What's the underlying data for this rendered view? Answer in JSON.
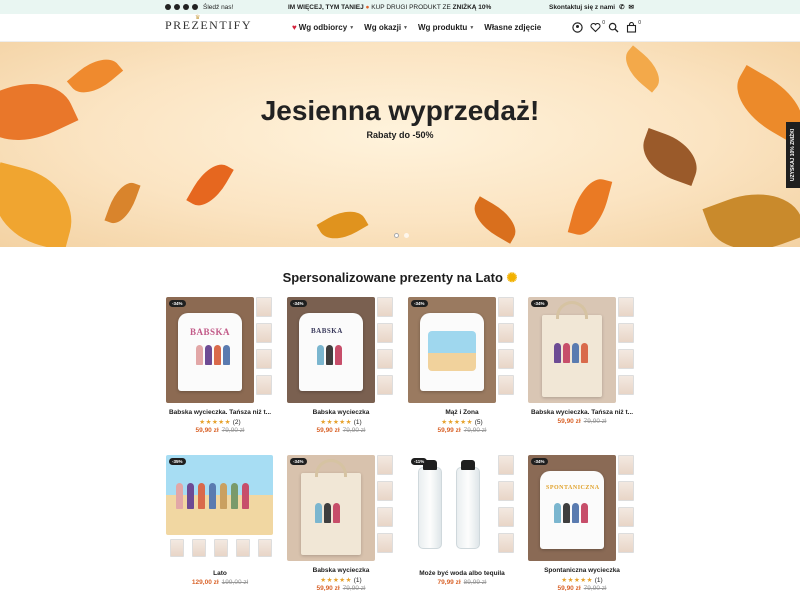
{
  "topbar": {
    "follow_label": "Śledź nas!",
    "promo_bold": "IM WIĘCEJ, TYM TANIEJ",
    "promo_mid": "KUP DRUGI PRODUKT ZE",
    "promo_discount": "ZNIŻKĄ 10%",
    "contact_label": "Skontaktuj się z nami",
    "social_icons": [
      "facebook-icon",
      "pinterest-icon",
      "instagram-icon",
      "tiktok-icon"
    ]
  },
  "header": {
    "logo": "PREZENTIFY",
    "nav": [
      {
        "label": "Wg odbiorcy",
        "dropdown": true,
        "heart": true
      },
      {
        "label": "Wg okazji",
        "dropdown": true
      },
      {
        "label": "Wg produktu",
        "dropdown": true
      },
      {
        "label": "Własne zdjęcie",
        "dropdown": false
      }
    ],
    "wishlist_count": "0",
    "cart_count": "0"
  },
  "hero": {
    "title": "Jesienna wyprzedaż!",
    "subtitle": "Rabaty do -50%",
    "slides": 2,
    "active_slide": 1
  },
  "side_tab": {
    "label": "UZYSKAJ 10% ZNIŻKI"
  },
  "section": {
    "title": "Spersonalizowane prezenty na Lato"
  },
  "products": [
    {
      "discount": "-34%",
      "title": "Babska wycieczka. Tańsza niż t...",
      "rating_count": "(2)",
      "price": "59,90 zł",
      "old_price": "79,90 zł",
      "stars": 5
    },
    {
      "discount": "-34%",
      "title": "Babska wycieczka",
      "rating_count": "(1)",
      "price": "59,90 zł",
      "old_price": "79,90 zł",
      "stars": 5
    },
    {
      "discount": "-34%",
      "title": "Mąż i Żona",
      "rating_count": "(5)",
      "price": "59,99 zł",
      "old_price": "79,90 zł",
      "stars": 5
    },
    {
      "discount": "-34%",
      "title": "Babska wycieczka. Tańsza niż t...",
      "rating_count": "",
      "price": "59,90 zł",
      "old_price": "79,90 zł",
      "stars": 0
    },
    {
      "discount": "-35%",
      "title": "Lato",
      "rating_count": "",
      "price": "129,00 zł",
      "old_price": "199,00 zł",
      "stars": 0
    },
    {
      "discount": "-34%",
      "title": "Babska wycieczka",
      "rating_count": "(1)",
      "price": "59,90 zł",
      "old_price": "79,90 zł",
      "stars": 5
    },
    {
      "discount": "-11%",
      "title": "Może być woda albo tequila",
      "rating_count": "",
      "price": "79,99 zł",
      "old_price": "89,99 zł",
      "stars": 0
    },
    {
      "discount": "-34%",
      "title": "Spontaniczna wycieczka",
      "rating_count": "(1)",
      "price": "59,90 zł",
      "old_price": "79,90 zł",
      "stars": 5
    }
  ],
  "colors": {
    "accent": "#d9642b",
    "topbar_bg": "#e9f6f2",
    "star": "#e6a12a",
    "heart": "#d3223b"
  }
}
